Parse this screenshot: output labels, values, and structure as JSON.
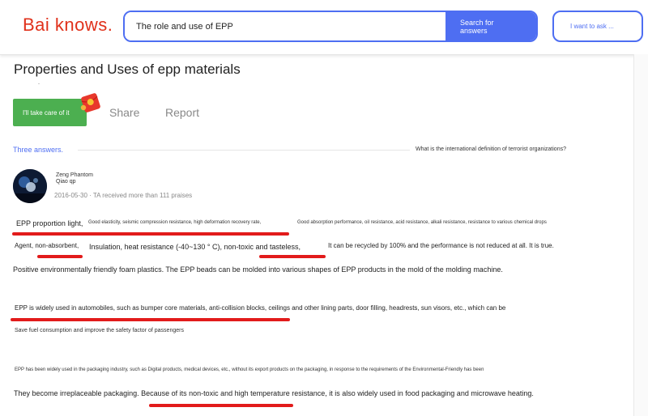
{
  "header": {
    "logo": "Bai knows.",
    "search_value": "The role and use of EPP",
    "search_button": "Search for answers",
    "ask_button": "I want to ask ..."
  },
  "question": {
    "title": "Properties and Uses of epp materials",
    "care_button": "I'll take care of it",
    "share_label": "Share",
    "report_label": "Report"
  },
  "answers_bar": {
    "count_label": "Three answers.",
    "related_question": "What is the international definition of terrorist organizations?"
  },
  "answer": {
    "user_name": "Zeng Phantom",
    "user_sub": "Qiao qp",
    "meta": "2016-05-30 · TA received more than 111 praises",
    "lines": {
      "l1a": "EPP proportion light,",
      "l1b": "Good elasticity, seismic compression resistance, high deformation recovery rate,",
      "l1c": "Good absorption performance, oil resistance, acid resistance, alkali resistance, resistance to various chemical drops",
      "l2a": "Agent, non-absorbent,",
      "l2b": "Insulation, heat resistance (-40~130 ° C), non-toxic and tasteless,",
      "l2c": "It can be recycled by 100% and the performance is not reduced at all. It is true.",
      "l3": "Positive environmentally friendly foam plastics. The EPP beads can be molded into various shapes of EPP products in the mold of the molding machine.",
      "l4": "EPP is widely used in automobiles, such as bumper core materials, anti-collision blocks, ceilings and other lining parts, door filling, headrests, sun visors, etc., which can be",
      "l5": "Save fuel consumption and improve the safety factor of passengers",
      "l6": "EPP has been widely used in the packaging industry, such as Digital products, medical devices, etc., without its export products on the packaging, in response to the requirements of the Environmental-Friendly has been",
      "l7": "They become irreplaceable packaging. Because of its non-toxic and high temperature resistance, it is also widely used in food packaging and microwave heating."
    }
  },
  "colors": {
    "brand_red": "#e0311b",
    "accent_blue": "#4e6ef2",
    "care_green": "#4caf50",
    "underline_red": "#e21b1b"
  },
  "icons": {
    "redpacket": "red-envelope-icon",
    "avatar": "user-avatar-image"
  }
}
